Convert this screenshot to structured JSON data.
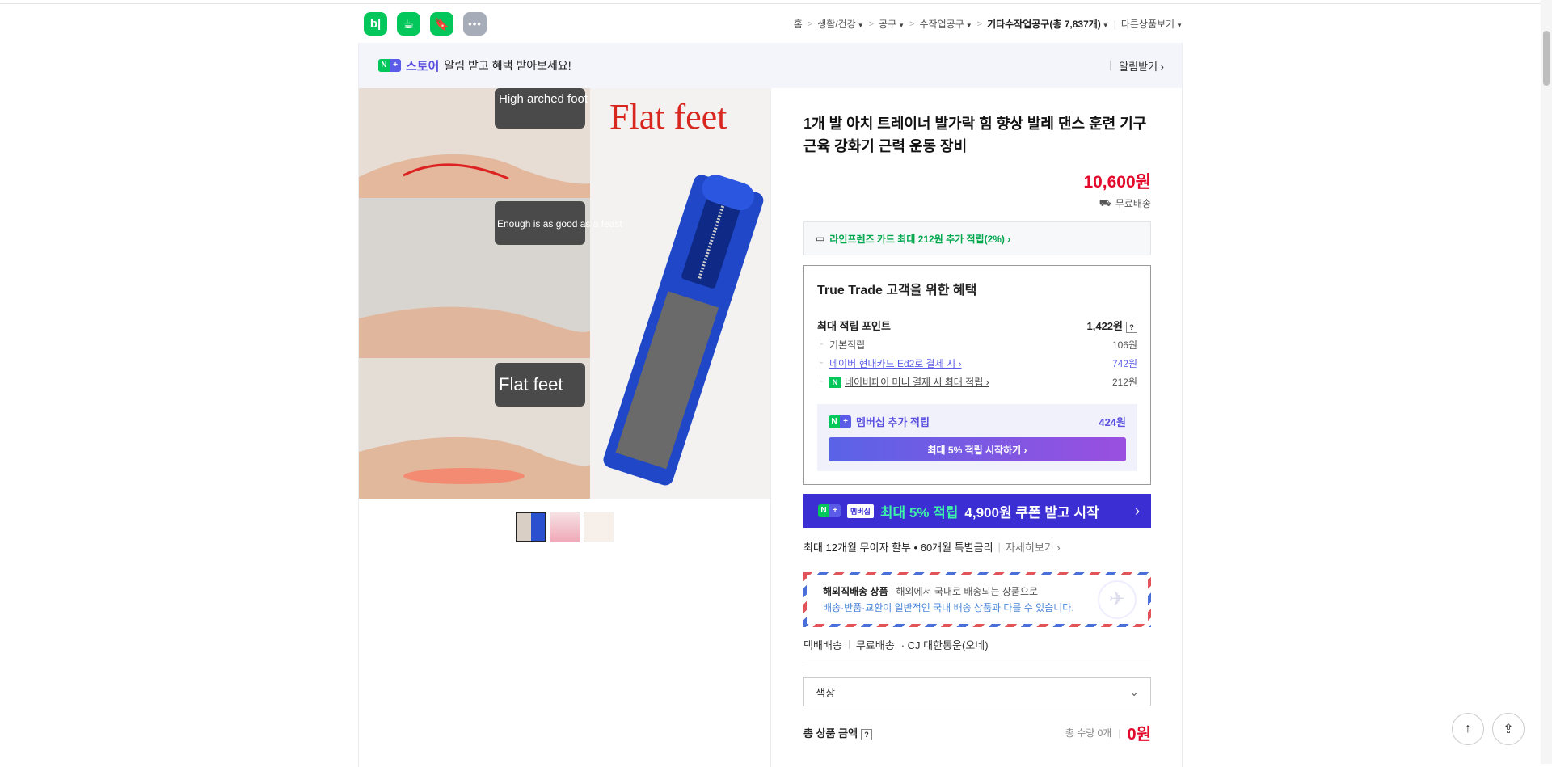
{
  "header": {
    "apps": [
      {
        "name": "blog-app-icon",
        "glyph": "b|",
        "style": "green"
      },
      {
        "name": "cafe-app-icon",
        "glyph": "☕",
        "style": "green"
      },
      {
        "name": "bookmark-app-icon",
        "glyph": "🔖",
        "style": "green"
      },
      {
        "name": "more-apps-icon",
        "glyph": "•••",
        "style": "gray"
      }
    ],
    "breadcrumb": {
      "home": "홈",
      "c1": "생활/건강",
      "c2": "공구",
      "c3": "수작업공구",
      "current": "기타수작업공구(총 7,837개)",
      "other": "다른상품보기"
    }
  },
  "banner": {
    "store": "스토어",
    "message": "알림 받고 혜택 받아보세요!",
    "notify": "알림받기 ›"
  },
  "product": {
    "image_text": {
      "label1": "High arched foot",
      "label2": "Enough is as good as a feast",
      "label3": "Flat feet",
      "big_label": "Flat feet"
    },
    "title": "1개 발 아치 트레이너 발가락 힘 향상 발레 댄스 훈련 기구 근육 강화기 근력 운동 장비",
    "price": "10,600원",
    "shipping": "무료배송",
    "card_offer": "라인프렌즈 카드 최대 212원 추가 적립(2%) ›"
  },
  "benefit": {
    "heading": "True Trade 고객을 위한 혜택",
    "max_points_label": "최대 적립 포인트",
    "max_points": "1,422원",
    "rows": [
      {
        "label": "기본적립",
        "value": "106원"
      },
      {
        "label": "네이버 현대카드 Ed2로 결제 시 ›",
        "value": "742원"
      },
      {
        "label": "네이버페이 머니 결제 시 최대 적립 ›",
        "value": "212원"
      }
    ],
    "membership_label": "멤버십 추가 적립",
    "membership_value": "424원",
    "membership_button": "최대 5% 적립 시작하기 ›"
  },
  "coupon": {
    "tag": "멤버십",
    "text_green": "최대 5% 적립",
    "text_white": "4,900원 쿠폰 받고 시작",
    "arrow": "›"
  },
  "installment": {
    "text": "최대 12개월 무이자 할부 • 60개월 특별금리",
    "more": "자세히보기 ›"
  },
  "overseas": {
    "title": "해외직배송 상품",
    "desc": "해외에서 국내로 배송되는 상품으로",
    "note": "배송·반품·교환이 일반적인 국내 배송 상품과 다를 수 있습니다."
  },
  "delivery": {
    "type": "택배배송",
    "fee": "무료배송",
    "carrier": "· CJ 대한통운(오네)"
  },
  "option": {
    "placeholder": "색상"
  },
  "total": {
    "label": "총 상품 금액",
    "qty": "총 수량 0개",
    "amount": "0원"
  },
  "colors": {
    "accent_green": "#03c75a",
    "price_red": "#e30a2c",
    "brand_purple": "#5a4fe0"
  }
}
